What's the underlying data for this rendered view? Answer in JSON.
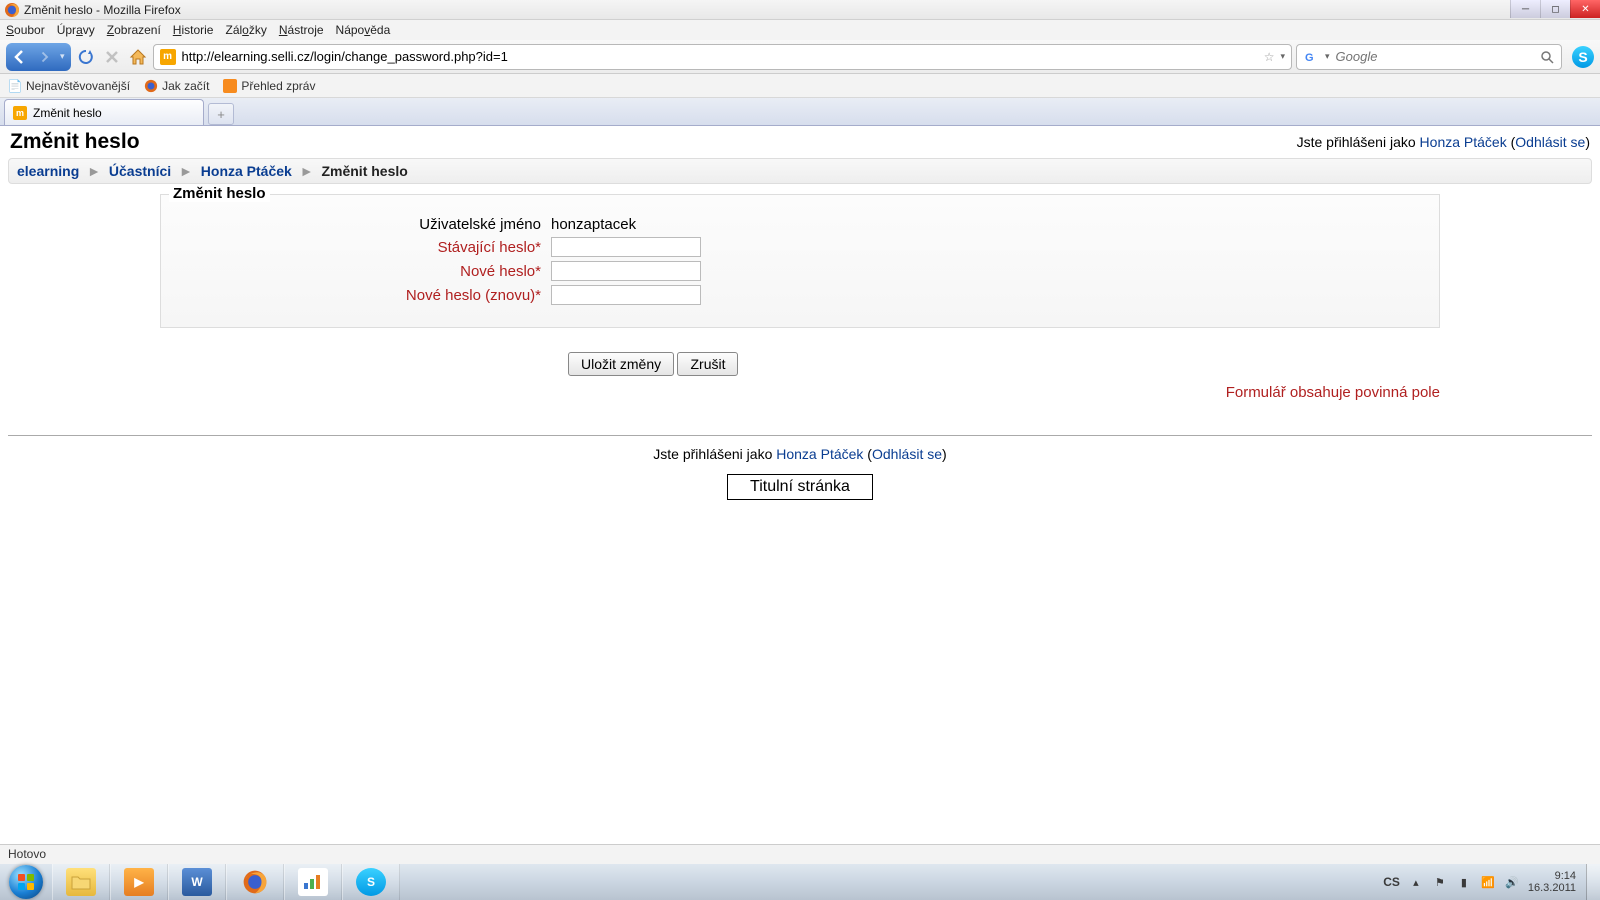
{
  "window": {
    "title": "Změnit heslo - Mozilla Firefox"
  },
  "menu": {
    "items": [
      "Soubor",
      "Úpravy",
      "Zobrazení",
      "Historie",
      "Záložky",
      "Nástroje",
      "Nápověda"
    ]
  },
  "nav": {
    "url": "http://elearning.selli.cz/login/change_password.php?id=1",
    "search_placeholder": "Google"
  },
  "bookmarks": {
    "items": [
      "Nejnavštěvovanější",
      "Jak začít",
      "Přehled zpráv"
    ]
  },
  "tabs": {
    "active": "Změnit heslo"
  },
  "page": {
    "title": "Změnit heslo",
    "login_prefix": "Jste přihlášeni jako ",
    "login_user": "Honza Ptáček",
    "logout": "Odhlásit se",
    "breadcrumb": {
      "items": [
        "elearning",
        "Účastníci",
        "Honza Ptáček"
      ],
      "current": "Změnit heslo"
    },
    "form": {
      "legend": "Změnit heslo",
      "username_label": "Uživatelské jméno",
      "username_value": "honzaptacek",
      "current_pw_label": "Stávající heslo*",
      "new_pw_label": "Nové heslo*",
      "new_pw2_label": "Nové heslo (znovu)*",
      "save": "Uložit změny",
      "cancel": "Zrušit",
      "required_note": "Formulář obsahuje povinná pole"
    },
    "footer": {
      "prefix": "Jste přihlášeni jako ",
      "user": "Honza Ptáček",
      "logout": "Odhlásit se",
      "home": "Titulní stránka"
    }
  },
  "status": {
    "text": "Hotovo"
  },
  "taskbar": {
    "lang": "CS",
    "time": "9:14",
    "date": "16.3.2011"
  }
}
